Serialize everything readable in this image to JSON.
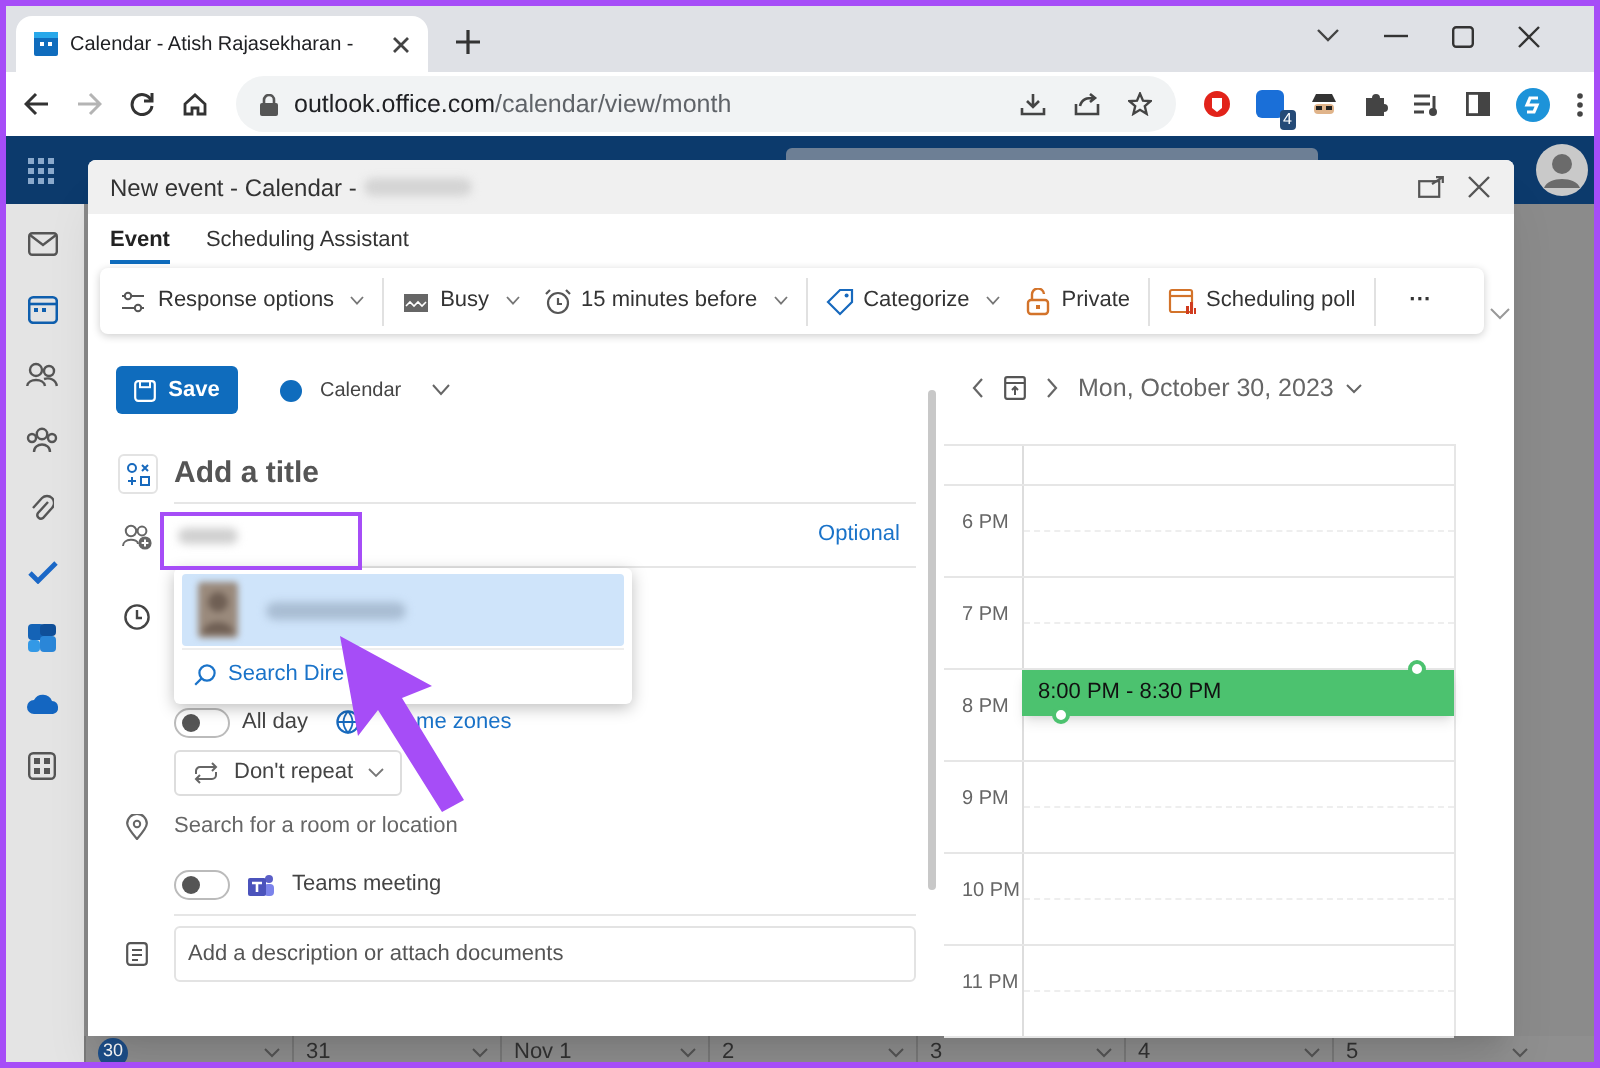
{
  "browser": {
    "tab_title": "Calendar - Atish Rajasekharan -",
    "url_host": "outlook.office.com",
    "url_path": "/calendar/view/month",
    "extension_badge": "4"
  },
  "dialog": {
    "title": "New event - Calendar - ",
    "tabs": [
      {
        "label": "Event",
        "selected": true
      },
      {
        "label": "Scheduling Assistant",
        "selected": false
      }
    ],
    "toolbar_groups": [
      [
        {
          "kind": "response",
          "label": "Response options",
          "dropdown": true
        }
      ],
      [
        {
          "kind": "busy",
          "label": "Busy",
          "dropdown": true
        },
        {
          "kind": "reminder",
          "label": "15 minutes before",
          "dropdown": true
        }
      ],
      [
        {
          "kind": "category",
          "label": "Categorize",
          "dropdown": true
        },
        {
          "kind": "private",
          "label": "Private",
          "dropdown": false
        }
      ],
      [
        {
          "kind": "poll",
          "label": "Scheduling poll",
          "dropdown": false
        }
      ],
      [
        {
          "kind": "more",
          "label": "···",
          "dropdown": false
        }
      ]
    ],
    "save": "Save",
    "calendar": {
      "label": "Calendar",
      "color": "#0f6cbd"
    },
    "title_placeholder": "Add a title",
    "optional": "Optional",
    "suggestion_action": "Search Dire",
    "all_day": {
      "label": "All day",
      "on": false
    },
    "time_zones": "me zones",
    "repeat": "Don't repeat",
    "location_placeholder": "Search for a room or location",
    "teams": {
      "label": "Teams meeting",
      "on": false
    },
    "description_placeholder": "Add a description or attach documents",
    "day_view": {
      "date": "Mon, October 30, 2023",
      "hours": [
        "6 PM",
        "7 PM",
        "8 PM",
        "9 PM",
        "10 PM",
        "11 PM"
      ],
      "event": {
        "time": "8:00 PM - 8:30 PM",
        "color": "#4cc26f"
      }
    }
  },
  "month_row": [
    "30",
    "31",
    "Nov 1",
    "2",
    "3",
    "4",
    "5"
  ]
}
